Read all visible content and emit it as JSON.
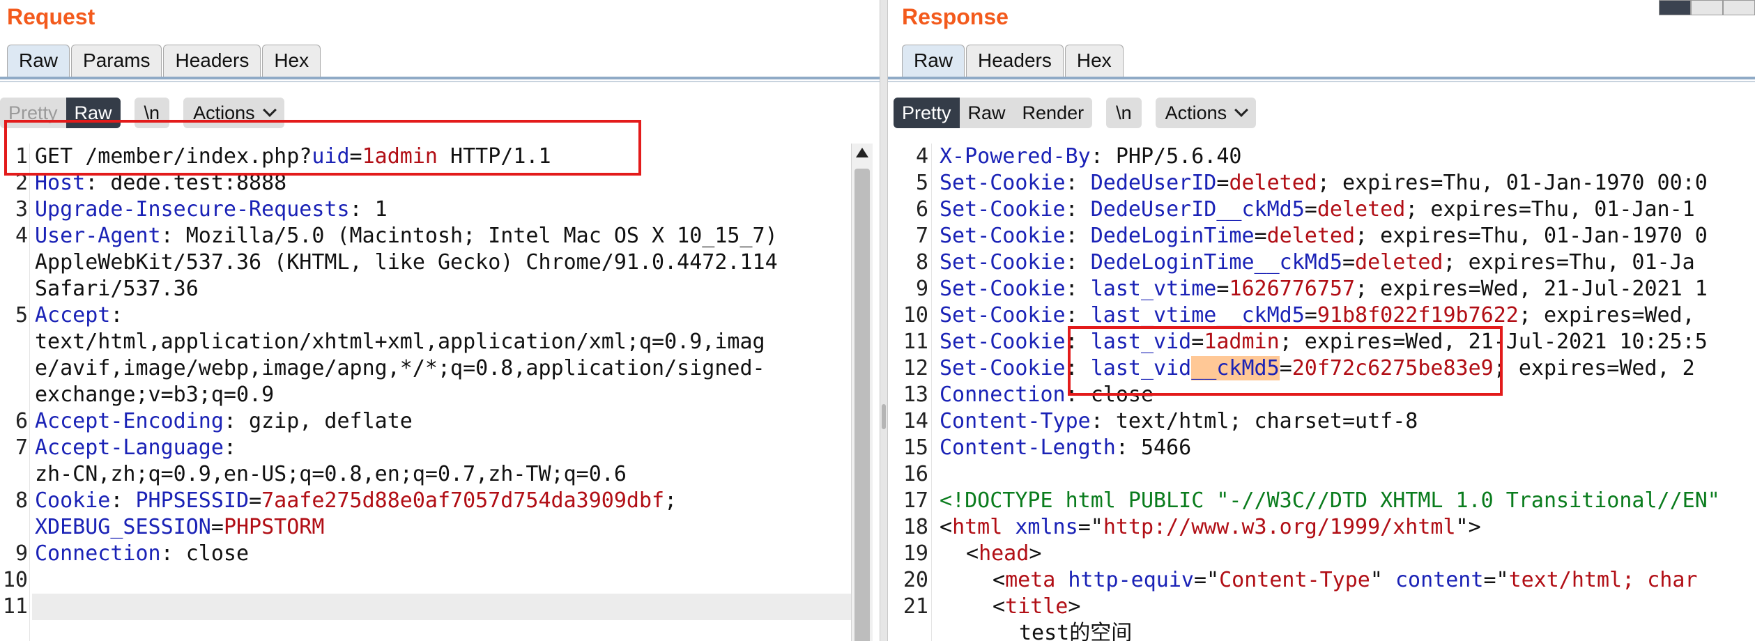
{
  "request": {
    "title": "Request",
    "tabs": [
      "Raw",
      "Params",
      "Headers",
      "Hex"
    ],
    "active_tab": "Raw",
    "view_modes": [
      "Pretty",
      "Raw"
    ],
    "newline_label": "\\n",
    "actions_label": "Actions",
    "lines": [
      {
        "num": "1",
        "parts": [
          [
            "GET /member/index.php?",
            ""
          ],
          [
            "uid",
            "p"
          ],
          [
            "=",
            ""
          ],
          [
            "1admin",
            "v"
          ],
          [
            " HTTP/1.1",
            ""
          ]
        ]
      },
      {
        "num": "2",
        "parts": [
          [
            "Host",
            "k"
          ],
          [
            ": dede.test:8888",
            ""
          ]
        ]
      },
      {
        "num": "3",
        "parts": [
          [
            "Upgrade-Insecure-Requests",
            "k"
          ],
          [
            ": 1",
            ""
          ]
        ]
      },
      {
        "num": "4",
        "parts": [
          [
            "User-Agent",
            "k"
          ],
          [
            ": Mozilla/5.0 (Macintosh; Intel Mac OS X 10_15_7)",
            ""
          ]
        ]
      },
      {
        "num": "",
        "parts": [
          [
            "AppleWebKit/537.36 (KHTML, like Gecko) Chrome/91.0.4472.114",
            ""
          ]
        ]
      },
      {
        "num": "",
        "parts": [
          [
            "Safari/537.36",
            ""
          ]
        ]
      },
      {
        "num": "5",
        "parts": [
          [
            "Accept",
            "k"
          ],
          [
            ":",
            ""
          ]
        ]
      },
      {
        "num": "",
        "parts": [
          [
            "text/html,application/xhtml+xml,application/xml;q=0.9,imag",
            ""
          ]
        ]
      },
      {
        "num": "",
        "parts": [
          [
            "e/avif,image/webp,image/apng,*/*;q=0.8,application/signed-",
            ""
          ]
        ]
      },
      {
        "num": "",
        "parts": [
          [
            "exchange;v=b3;q=0.9",
            ""
          ]
        ]
      },
      {
        "num": "6",
        "parts": [
          [
            "Accept-Encoding",
            "k"
          ],
          [
            ": gzip, deflate",
            ""
          ]
        ]
      },
      {
        "num": "7",
        "parts": [
          [
            "Accept-Language",
            "k"
          ],
          [
            ":",
            ""
          ]
        ]
      },
      {
        "num": "",
        "parts": [
          [
            "zh-CN,zh;q=0.9,en-US;q=0.8,en;q=0.7,zh-TW;q=0.6",
            ""
          ]
        ]
      },
      {
        "num": "8",
        "parts": [
          [
            "Cookie",
            "k"
          ],
          [
            ": ",
            ""
          ],
          [
            "PHPSESSID",
            "k"
          ],
          [
            "=",
            ""
          ],
          [
            "7aafe275d88e0af7057d754da3909dbf",
            "v"
          ],
          [
            ";",
            ""
          ]
        ]
      },
      {
        "num": "",
        "parts": [
          [
            "XDEBUG_SESSION",
            "k"
          ],
          [
            "=",
            ""
          ],
          [
            "PHPSTORM",
            "v"
          ]
        ]
      },
      {
        "num": "9",
        "parts": [
          [
            "Connection",
            "k"
          ],
          [
            ": close",
            ""
          ]
        ]
      },
      {
        "num": "10",
        "parts": []
      },
      {
        "num": "11",
        "parts": []
      }
    ]
  },
  "response": {
    "title": "Response",
    "tabs": [
      "Raw",
      "Headers",
      "Hex"
    ],
    "active_tab": "Raw",
    "view_modes": [
      "Pretty",
      "Raw",
      "Render"
    ],
    "newline_label": "\\n",
    "actions_label": "Actions",
    "lines": [
      {
        "num": "4",
        "indent": 0,
        "parts": [
          [
            "X-Powered-By",
            "k"
          ],
          [
            ": PHP/5.6.40",
            ""
          ]
        ]
      },
      {
        "num": "5",
        "indent": 0,
        "parts": [
          [
            "Set-Cookie",
            "k"
          ],
          [
            ": ",
            ""
          ],
          [
            "DedeUserID",
            "k"
          ],
          [
            "=",
            ""
          ],
          [
            "deleted",
            "v"
          ],
          [
            "; expires=Thu, 01-Jan-1970 00:0",
            ""
          ]
        ]
      },
      {
        "num": "6",
        "indent": 0,
        "parts": [
          [
            "Set-Cookie",
            "k"
          ],
          [
            ": ",
            ""
          ],
          [
            "DedeUserID__ckMd5",
            "k"
          ],
          [
            "=",
            ""
          ],
          [
            "deleted",
            "v"
          ],
          [
            "; expires=Thu, 01-Jan-1",
            ""
          ]
        ]
      },
      {
        "num": "7",
        "indent": 0,
        "parts": [
          [
            "Set-Cookie",
            "k"
          ],
          [
            ": ",
            ""
          ],
          [
            "DedeLoginTime",
            "k"
          ],
          [
            "=",
            ""
          ],
          [
            "deleted",
            "v"
          ],
          [
            "; expires=Thu, 01-Jan-1970 0",
            ""
          ]
        ]
      },
      {
        "num": "8",
        "indent": 0,
        "parts": [
          [
            "Set-Cookie",
            "k"
          ],
          [
            ": ",
            ""
          ],
          [
            "DedeLoginTime__ckMd5",
            "k"
          ],
          [
            "=",
            ""
          ],
          [
            "deleted",
            "v"
          ],
          [
            "; expires=Thu, 01-Ja",
            ""
          ]
        ]
      },
      {
        "num": "9",
        "indent": 0,
        "parts": [
          [
            "Set-Cookie",
            "k"
          ],
          [
            ": ",
            ""
          ],
          [
            "last_vtime",
            "k"
          ],
          [
            "=",
            ""
          ],
          [
            "1626776757",
            "v"
          ],
          [
            "; expires=Wed, 21-Jul-2021 1",
            ""
          ]
        ]
      },
      {
        "num": "10",
        "indent": 0,
        "parts": [
          [
            "Set-Cookie",
            "k"
          ],
          [
            ": ",
            ""
          ],
          [
            "last_vtime__ckMd5",
            "k"
          ],
          [
            "=",
            ""
          ],
          [
            "91b8f022f19b7622",
            "v"
          ],
          [
            "; expires=Wed,",
            ""
          ]
        ]
      },
      {
        "num": "11",
        "indent": 0,
        "parts": [
          [
            "Set-Cookie",
            "k"
          ],
          [
            ": ",
            ""
          ],
          [
            "last_vid",
            "k"
          ],
          [
            "=",
            ""
          ],
          [
            "1admin",
            "v"
          ],
          [
            "; expires=Wed, 21-Jul-2021 10:25:5",
            ""
          ]
        ]
      },
      {
        "num": "12",
        "indent": 0,
        "parts": [
          [
            "Set-Cookie",
            "k"
          ],
          [
            ": ",
            ""
          ],
          [
            "last_vid",
            "k"
          ],
          [
            "__ckMd5",
            "km"
          ],
          [
            "=",
            ""
          ],
          [
            "20f72c6275be83e9",
            "v"
          ],
          [
            "; expires=Wed, 2",
            ""
          ]
        ]
      },
      {
        "num": "13",
        "indent": 0,
        "parts": [
          [
            "Connection",
            "k"
          ],
          [
            ": close",
            ""
          ]
        ]
      },
      {
        "num": "14",
        "indent": 0,
        "parts": [
          [
            "Content-Type",
            "k"
          ],
          [
            ": text/html; charset=utf-8",
            ""
          ]
        ]
      },
      {
        "num": "15",
        "indent": 0,
        "parts": [
          [
            "Content-Length",
            "k"
          ],
          [
            ": 5466",
            ""
          ]
        ]
      },
      {
        "num": "16",
        "indent": 0,
        "parts": []
      },
      {
        "num": "17",
        "indent": 0,
        "parts": [
          [
            "<!DOCTYPE html PUBLIC \"-//W3C//DTD XHTML 1.0 Transitional//EN\"",
            "m"
          ]
        ]
      },
      {
        "num": "18",
        "indent": 0,
        "parts": [
          [
            "<",
            ""
          ],
          [
            "html",
            "v"
          ],
          [
            " ",
            ""
          ],
          [
            "xmlns",
            "k"
          ],
          [
            "=\"",
            ""
          ],
          [
            "http://www.w3.org/1999/xhtml",
            "v"
          ],
          [
            "\">",
            ""
          ]
        ]
      },
      {
        "num": "19",
        "indent": 1,
        "parts": [
          [
            "<",
            ""
          ],
          [
            "head",
            "v"
          ],
          [
            ">",
            ""
          ]
        ]
      },
      {
        "num": "20",
        "indent": 2,
        "parts": [
          [
            "<",
            ""
          ],
          [
            "meta",
            "v"
          ],
          [
            " ",
            ""
          ],
          [
            "http-equiv",
            "k"
          ],
          [
            "=\"",
            ""
          ],
          [
            "Content-Type",
            "v"
          ],
          [
            "\" ",
            ""
          ],
          [
            "content",
            "k"
          ],
          [
            "=\"",
            ""
          ],
          [
            "text/html; char",
            "v"
          ]
        ]
      },
      {
        "num": "21",
        "indent": 2,
        "parts": [
          [
            "<",
            ""
          ],
          [
            "title",
            "v"
          ],
          [
            ">",
            ""
          ]
        ]
      },
      {
        "num": "",
        "indent": 3,
        "parts": [
          [
            "test的空间",
            ""
          ]
        ]
      }
    ]
  }
}
